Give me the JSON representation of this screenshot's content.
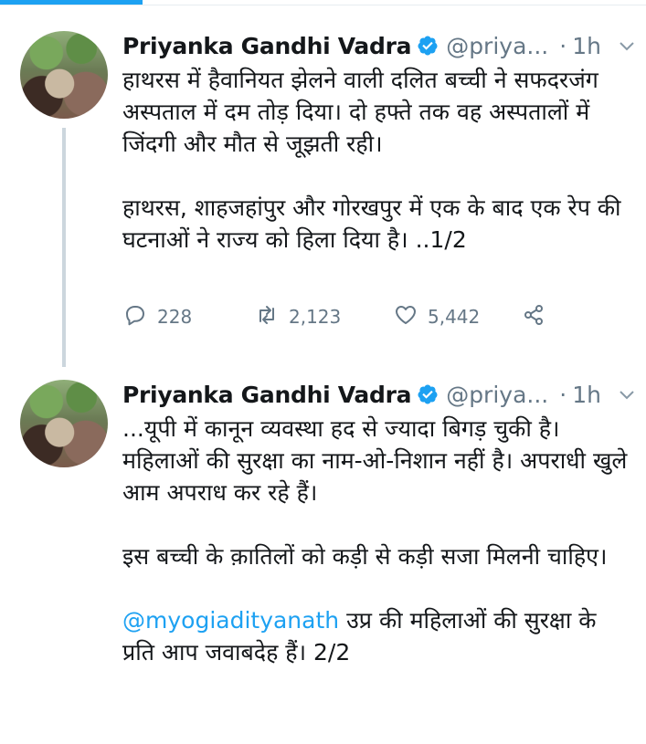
{
  "colors": {
    "accent": "#1da1f2",
    "text": "#14171a",
    "muted": "#657786",
    "thread_line": "#ccd6dd"
  },
  "tweets": [
    {
      "author": "Priyanka Gandhi Vadra",
      "handle": "@priya...",
      "dot": "·",
      "time": "1h",
      "paragraphs": [
        "हाथरस में हैवानियत झेलने वाली दलित बच्ची ने सफदरजंग अस्पताल में दम तोड़ दिया। दो हफ्ते तक वह अस्पतालों में जिंदगी और मौत से जूझती रही।",
        "हाथरस, शाहजहांपुर और गोरखपुर में एक के बाद एक रेप की घटनाओं ने राज्य को हिला दिया है। ..1/2"
      ],
      "stats": {
        "replies": "228",
        "retweets": "2,123",
        "likes": "5,442"
      },
      "icons": {
        "avatar": "avatar",
        "verified": "verified-badge-icon",
        "more": "chevron-down-icon"
      }
    },
    {
      "author": "Priyanka Gandhi Vadra",
      "handle": "@priya...",
      "dot": "·",
      "time": "1h",
      "paragraphs": [
        "...यूपी में कानून व्यवस्था हद से ज्यादा बिगड़ चुकी है। महिलाओं की सुरक्षा का नाम-ओ-निशान नहीं है। अपराधी खुले आम अपराध कर रहे हैं।",
        "इस बच्ची के क़ातिलों को कड़ी से कड़ी सजा मिलनी चाहिए।"
      ],
      "mention": "@myogiadityanath",
      "last_paragraph_rest": " उप्र की महिलाओं की सुरक्षा के प्रति आप जवाबदेह हैं। 2/2"
    }
  ]
}
